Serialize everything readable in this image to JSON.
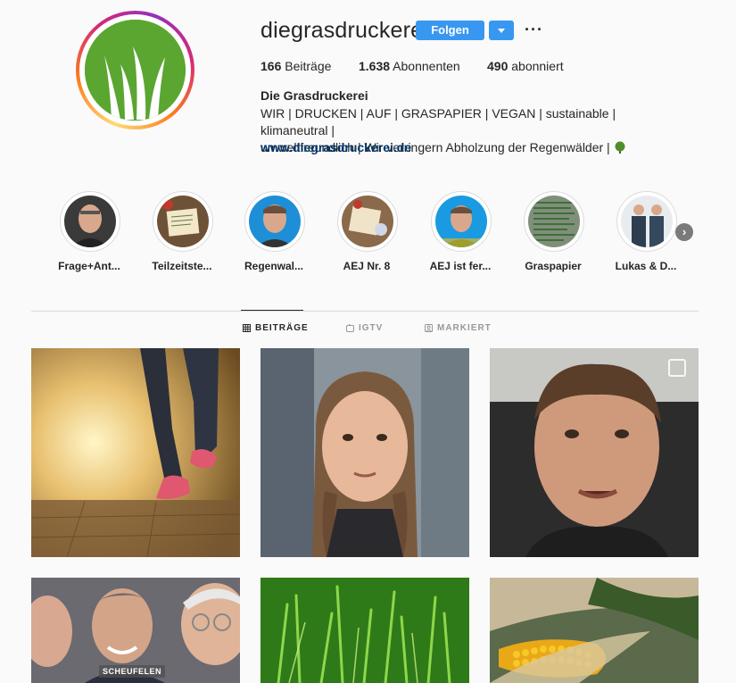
{
  "profile": {
    "username": "diegrasdruckerei",
    "follow_label": "Folgen",
    "more_label": "···",
    "stats": {
      "posts_count": "166",
      "posts_label": "Beiträge",
      "followers_count": "1.638",
      "followers_label": "Abonnenten",
      "following_count": "490",
      "following_label": "abonniert"
    },
    "bio_name": "Die Grasdruckerei",
    "bio_line1": "WIR | DRUCKEN | AUF | GRASPAPIER | VEGAN | sustainable | klimaneutral |",
    "bio_line2": "umweltfreundlich | Wir verringern Abholzung der Regenwälder |",
    "website": "www.diegrasdruckerei.de",
    "colors": {
      "accent": "#3897f0",
      "link": "#003569",
      "brand_green": "#5aa631"
    }
  },
  "highlights": [
    {
      "label": "Frage+Ant..."
    },
    {
      "label": "Teilzeitste..."
    },
    {
      "label": "Regenwal..."
    },
    {
      "label": "AEJ Nr. 8"
    },
    {
      "label": "AEJ ist fer..."
    },
    {
      "label": "Graspapier"
    },
    {
      "label": "Lukas & D..."
    }
  ],
  "tabs": [
    {
      "label": "BEITRÄGE",
      "icon": "grid-icon",
      "active": true
    },
    {
      "label": "IGTV",
      "icon": "igtv-icon",
      "active": false
    },
    {
      "label": "MARKIERT",
      "icon": "tagged-icon",
      "active": false
    }
  ],
  "posts": [
    {
      "overlay": ""
    },
    {
      "overlay": ""
    },
    {
      "overlay": ""
    },
    {
      "overlay": "SCHEUFELEN"
    },
    {
      "overlay": ""
    },
    {
      "overlay": ""
    }
  ]
}
